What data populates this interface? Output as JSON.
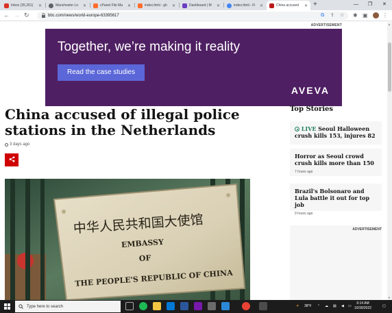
{
  "browser": {
    "tabs": [
      {
        "label": "Inbox (35,261)",
        "favicon_color": "#d93025"
      },
      {
        "label": "Manchester Lo",
        "favicon_color": "#5f6368"
      },
      {
        "label": "cPanel File Ma",
        "favicon_color": "#ff6c2c"
      },
      {
        "label": "index.html - gh",
        "favicon_color": "#ff6c2c"
      },
      {
        "label": "Dashboard | M",
        "favicon_color": "#6c3fc1"
      },
      {
        "label": "index.html - Fi",
        "favicon_color": "#4285f4"
      },
      {
        "label": "China accused",
        "favicon_color": "#bb1919",
        "active": true
      }
    ],
    "new_tab_symbol": "+",
    "window_controls": {
      "minimize": "—",
      "maximize": "❐",
      "close": "✕"
    },
    "url": "bbc.com/news/world-europe-63395617"
  },
  "ad": {
    "label": "ADVERTISEMENT",
    "headline": "Together, we’re making it reality",
    "button_label": "Read the case studies",
    "logo": "AVEVA",
    "background_color": "#4f1f63",
    "button_color": "#5b67d8"
  },
  "article": {
    "title": "China accused of illegal police stations in the Netherlands",
    "timestamp": "3 days ago",
    "share_icon": "share-icon",
    "hero_image": {
      "sign_chinese": "中华人民共和国大使馆",
      "sign_line1": "EMBASSY",
      "sign_line2": "OF",
      "sign_line3": "THE PEOPLE'S REPUBLIC OF CHINA"
    }
  },
  "sidebar": {
    "heading": "Top Stories",
    "stories": [
      {
        "live": "LIVE",
        "title": "Seoul Halloween crush kills 153, injures 82",
        "time": ""
      },
      {
        "title": "Horror as Seoul crowd crush kills more than 150",
        "time": "7 hours ago"
      },
      {
        "title": "Brazil's Bolsonaro and Lula battle it out for top job",
        "time": "9 hours ago"
      }
    ],
    "ad_label": "ADVERTISEMENT"
  },
  "taskbar": {
    "search_placeholder": "Type here to search",
    "weather": "38°F",
    "time": "6:14 AM",
    "date": "10/30/2022"
  }
}
